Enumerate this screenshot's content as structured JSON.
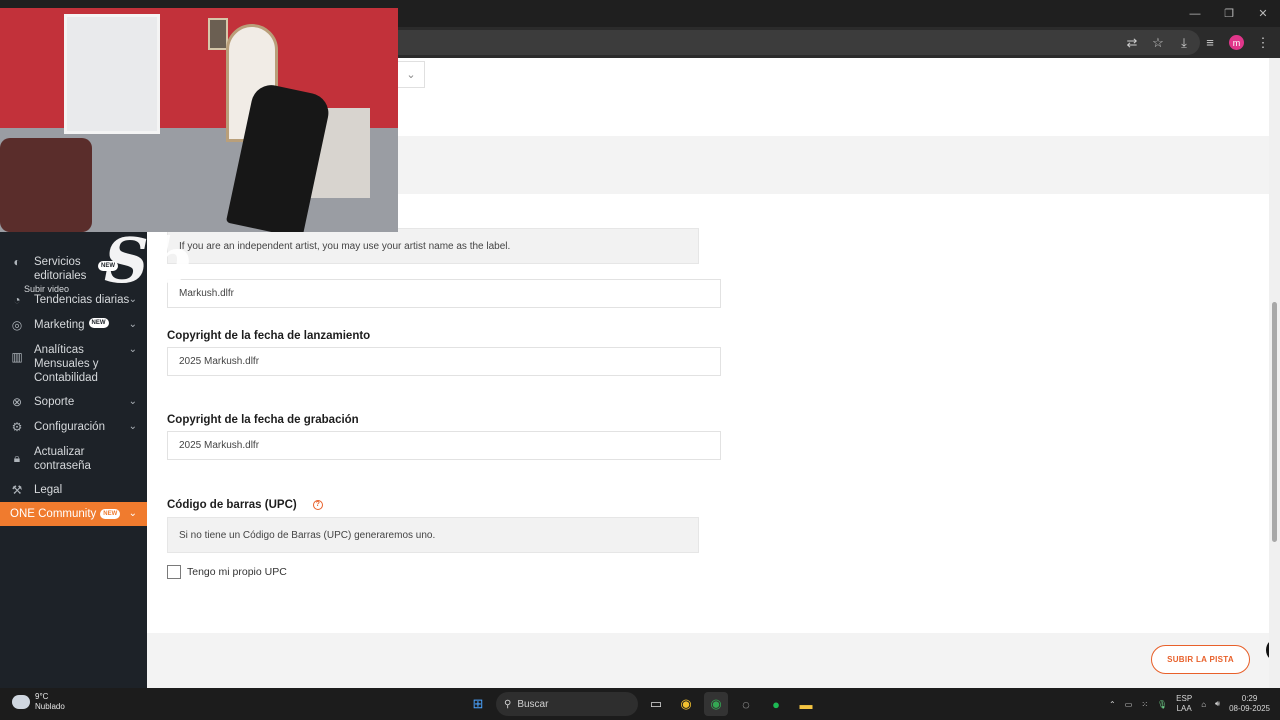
{
  "window": {
    "minimize": "—",
    "restore": "❐",
    "close": "✕"
  },
  "toolbar": {
    "profile_initial": "m"
  },
  "sidebar": {
    "partial_item": "Subir video",
    "items": [
      {
        "label": "Servicios editoriales",
        "icon": "editorial-icon",
        "badge": "NEW",
        "chevron": false
      },
      {
        "label": "Tendencias diarias",
        "icon": "trends-icon",
        "badge": "",
        "chevron": true
      },
      {
        "label": "Marketing",
        "icon": "target-icon",
        "badge": "NEW",
        "chevron": true
      },
      {
        "label": "Analíticas Mensuales y Contabilidad",
        "icon": "analytics-icon",
        "badge": "",
        "chevron": true
      },
      {
        "label": "Soporte",
        "icon": "support-icon",
        "badge": "",
        "chevron": true
      },
      {
        "label": "Configuración",
        "icon": "gear-icon",
        "badge": "",
        "chevron": true
      },
      {
        "label": "Actualizar contraseña",
        "icon": "lock-icon",
        "badge": "",
        "chevron": false
      },
      {
        "label": "Legal",
        "icon": "gavel-icon",
        "badge": "",
        "chevron": false
      },
      {
        "label": "ONE Community",
        "icon": "",
        "badge": "NEW",
        "chevron": true
      }
    ]
  },
  "form": {
    "label_info": "If you are an independent artist, you may use your artist name as the label.",
    "label_value": "Markush.dlfr",
    "release_copyright": {
      "label": "Copyright de la fecha de lanzamiento",
      "value": "2025 Markush.dlfr"
    },
    "recording_copyright": {
      "label": "Copyright de la fecha de grabación",
      "value": "2025 Markush.dlfr"
    },
    "upc": {
      "label": "Código de barras (UPC)",
      "info": "Si no tiene un Código de Barras (UPC) generaremos uno.",
      "checkbox_label": "Tengo mi propio UPC",
      "checked": false
    },
    "submit_label": "SUBIR LA PISTA"
  },
  "overlay": {
    "watermark_text": "Sb"
  },
  "taskbar": {
    "weather_temp": "9°C",
    "weather_desc": "Nublado",
    "search_placeholder": "Buscar",
    "lang_top": "ESP",
    "lang_bottom": "LAA",
    "time": "0:29",
    "date": "08-09-2025"
  },
  "colors": {
    "accent": "#f07b2e",
    "sidebar_bg": "#1d2228",
    "band_bg": "#f3f3f3"
  }
}
